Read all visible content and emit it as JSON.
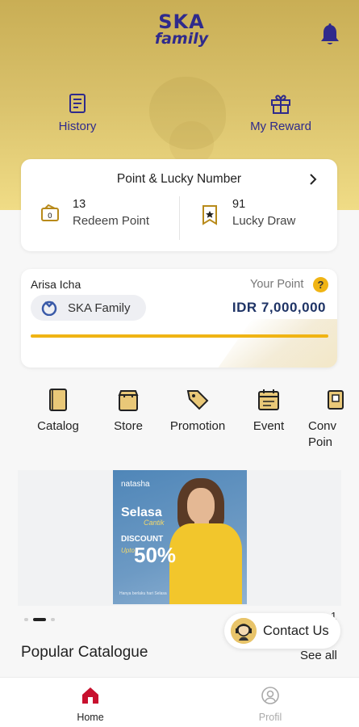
{
  "header": {
    "logo_line1": "SKA",
    "logo_line2": "family",
    "bell_icon": "bell-icon",
    "accent_color": "#2f2a8c",
    "actions": [
      {
        "label": "History",
        "icon": "history-icon"
      },
      {
        "label": "My Reward",
        "icon": "gift-icon"
      }
    ]
  },
  "points_card": {
    "title": "Point & Lucky Number",
    "redeem": {
      "value": "13",
      "label": "Redeem Point",
      "icon": "coupon-icon"
    },
    "lucky": {
      "value": "91",
      "label": "Lucky Draw",
      "icon": "ticket-star-icon"
    }
  },
  "member": {
    "name": "Arisa Icha",
    "tier": "SKA Family",
    "your_point_label": "Your Point",
    "help_glyph": "?",
    "amount": "IDR 7,000,000",
    "progress_percent": 100,
    "progress_color": "#f0b414"
  },
  "menu": [
    {
      "label": "Catalog",
      "icon": "catalog-icon"
    },
    {
      "label": "Store",
      "icon": "store-bag-icon"
    },
    {
      "label": "Promotion",
      "icon": "tag-icon"
    },
    {
      "label": "Event",
      "icon": "calendar-icon"
    },
    {
      "label": "Conv\nPoin",
      "icon": "convert-point-icon"
    }
  ],
  "banner": {
    "brand": "natasha",
    "headline": "Selasa",
    "script": "Cantik",
    "discount": "DISCOUNT",
    "upto": "Upto",
    "percent": "50%",
    "fine_print": "Hanya berlaku hari Selasa"
  },
  "carousel": {
    "count": 3,
    "active": 1
  },
  "contact": {
    "label": "Contact Us",
    "mark": "1"
  },
  "popular": {
    "title": "Popular Catalogue",
    "see_all": "See all"
  },
  "tabbar": {
    "items": [
      {
        "label": "Home",
        "icon": "home-icon",
        "active": true
      },
      {
        "label": "Profil",
        "icon": "profile-icon",
        "active": false
      }
    ]
  }
}
